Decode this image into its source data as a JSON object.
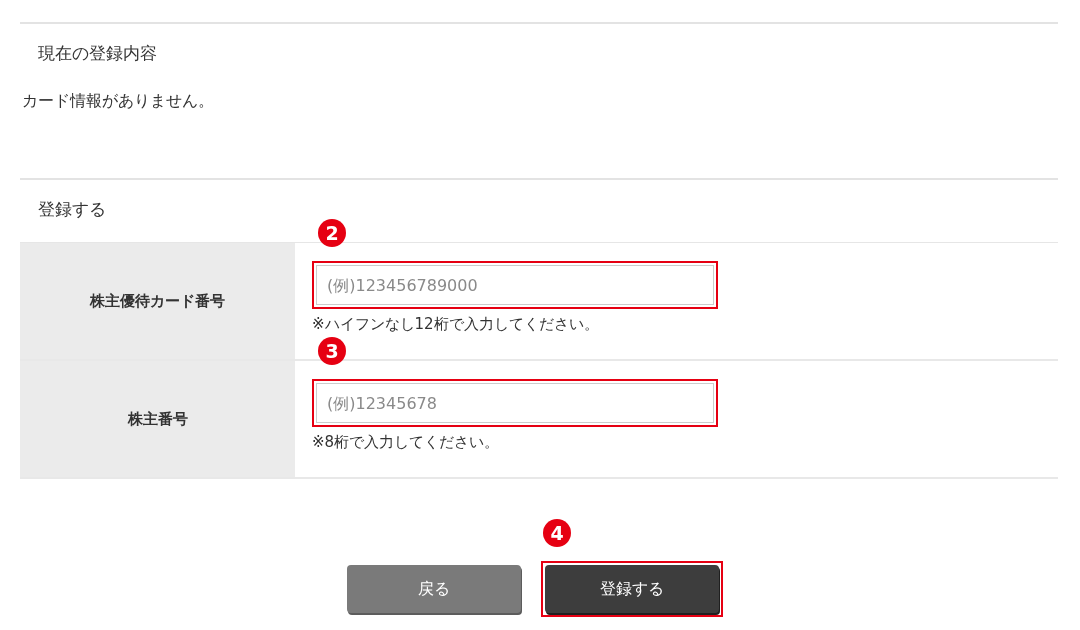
{
  "current": {
    "heading": "現在の登録内容",
    "message": "カード情報がありません。"
  },
  "register": {
    "heading": "登録する",
    "fields": [
      {
        "label": "株主優待カード番号",
        "placeholder": "(例)123456789000",
        "note": "※ハイフンなし12桁で入力してください。",
        "callout": "2",
        "highlighted": true
      },
      {
        "label": "株主番号",
        "placeholder": "(例)12345678",
        "note": "※8桁で入力してください。",
        "callout": "3",
        "highlighted": true
      }
    ]
  },
  "buttons": [
    {
      "label": "戻る",
      "kind": "secondary",
      "highlighted": false
    },
    {
      "label": "登録する",
      "kind": "primary",
      "callout": "4",
      "highlighted": true
    }
  ]
}
